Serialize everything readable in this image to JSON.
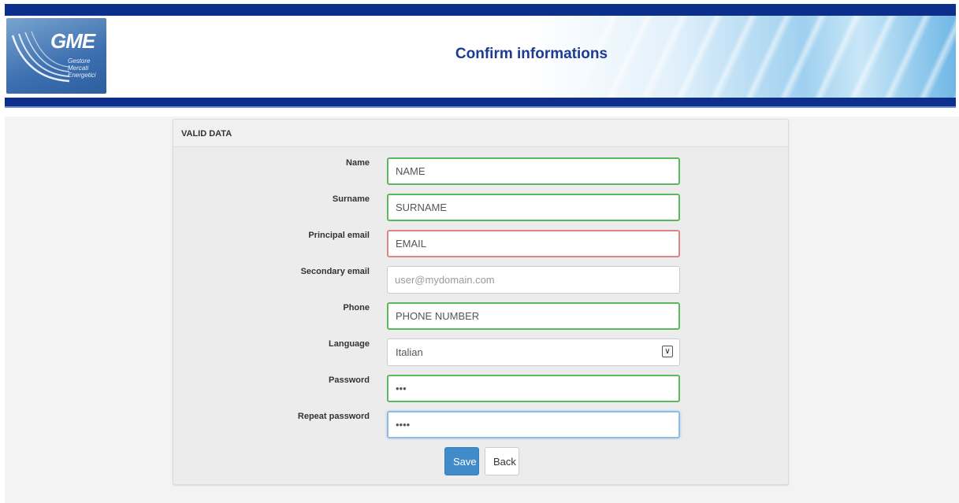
{
  "header": {
    "title": "Confirm informations",
    "logo": {
      "brand": "GME",
      "subtitle_lines": [
        "Gestore",
        "Mercati",
        "Energetici"
      ]
    }
  },
  "panel": {
    "heading": "Valid data"
  },
  "form": {
    "name": {
      "label": "Name",
      "value": "NAME",
      "state": "valid"
    },
    "surname": {
      "label": "Surname",
      "value": "SURNAME",
      "state": "valid"
    },
    "principal_email": {
      "label": "Principal email",
      "value": "EMAIL",
      "state": "invalid"
    },
    "secondary_email": {
      "label": "Secondary email",
      "value": "",
      "placeholder": "user@mydomain.com"
    },
    "phone": {
      "label": "Phone",
      "value": "PHONE NUMBER",
      "state": "valid"
    },
    "language": {
      "label": "Language",
      "selected": "Italian"
    },
    "password": {
      "label": "Password",
      "value": "abc",
      "state": "valid"
    },
    "repeat_password": {
      "label": "Repeat password",
      "value": "abcd",
      "state": "focused"
    }
  },
  "buttons": {
    "save": "Save",
    "back": "Back"
  },
  "colors": {
    "brand_bar": "#0b2f8a",
    "title": "#1d3b91",
    "valid_border": "#5cb85c",
    "invalid_border": "#e08585",
    "primary_button": "#428bca"
  },
  "icons": {
    "select_arrow": "chevron-down-icon"
  }
}
